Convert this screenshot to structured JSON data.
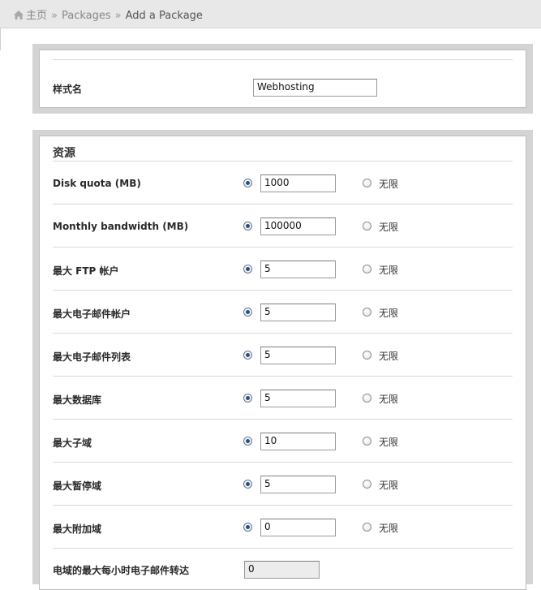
{
  "breadcrumb": {
    "home": "主页",
    "separator": "»",
    "packages": "Packages",
    "current": "Add a Package"
  },
  "package_name": {
    "label": "样式名",
    "value": "Webhosting"
  },
  "resources": {
    "title": "资源",
    "unlimited_label": "无限",
    "rows": [
      {
        "label": "Disk quota (MB)",
        "value": "1000",
        "limited": true
      },
      {
        "label": "Monthly bandwidth (MB)",
        "value": "100000",
        "limited": true
      },
      {
        "label": "最大 FTP 帐户",
        "value": "5",
        "limited": true
      },
      {
        "label": "最大电子邮件帐户",
        "value": "5",
        "limited": true
      },
      {
        "label": "最大电子邮件列表",
        "value": "5",
        "limited": true
      },
      {
        "label": "最大数据库",
        "value": "5",
        "limited": true
      },
      {
        "label": "最大子域",
        "value": "10",
        "limited": true
      },
      {
        "label": "最大暂停域",
        "value": "5",
        "limited": true
      },
      {
        "label": "最大附加域",
        "value": "0",
        "limited": true
      }
    ],
    "partial_row": {
      "label": "电域的最大每小时电子邮件转达",
      "value": "0"
    }
  },
  "colors": {
    "header_bg": "#e8e8e8",
    "panel_frame": "#d4d4d4",
    "radio_dot": "#2d4f76"
  }
}
